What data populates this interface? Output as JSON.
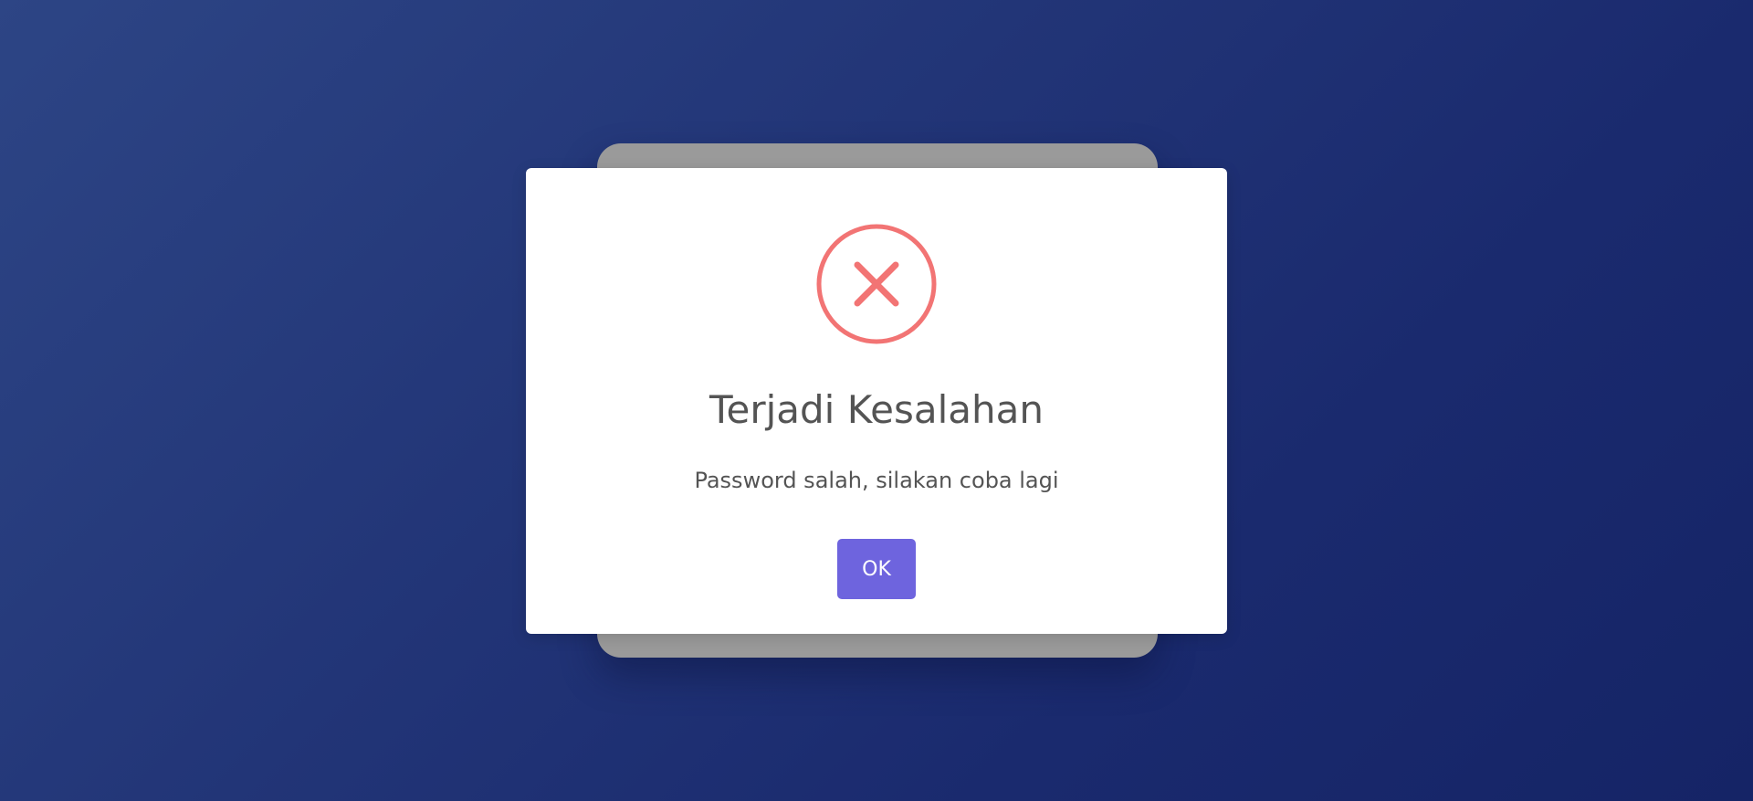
{
  "dialog": {
    "icon": "error-x-circle-icon",
    "title": "Terjadi Kesalahan",
    "message": "Password salah, silakan coba lagi",
    "confirm_label": "OK"
  },
  "colors": {
    "background_start": "#2d4585",
    "background_end": "#152466",
    "error_icon": "#f27474",
    "confirm_button": "#6e64de",
    "backdrop_card": "#9a9a9a",
    "text": "#545454"
  }
}
